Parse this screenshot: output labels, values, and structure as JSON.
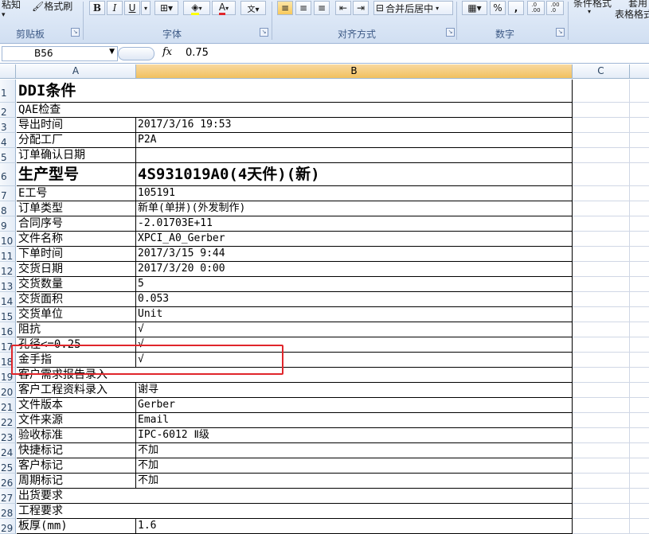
{
  "ribbon": {
    "clipboard": {
      "cut_partial": "粘知",
      "format_painter": "格式刷",
      "group_label": "剪贴板"
    },
    "font": {
      "bold": "B",
      "italic": "I",
      "underline": "U",
      "font_color": "A",
      "wen": "wén\n文",
      "group_label": "字体"
    },
    "alignment": {
      "merge_center": "合并后居中",
      "group_label": "对齐方式"
    },
    "number": {
      "percent": "%",
      "comma": ",",
      "inc_decimal": ".0\n.00",
      "dec_decimal": ".00\n.0",
      "group_label": "数字"
    },
    "styles": {
      "conditional_partial": "条件格式",
      "table_format_partial": "表格格式",
      "cell_styles_partial": "套用"
    }
  },
  "formula_bar": {
    "name_box": "B56",
    "fx": "fx",
    "value": "0.75"
  },
  "columns": [
    "A",
    "B",
    "C"
  ],
  "rows": [
    {
      "n": "1",
      "a": "DDI条件",
      "b": "",
      "style": "title"
    },
    {
      "n": "2",
      "a": "QAE检查",
      "b": "",
      "style": "span"
    },
    {
      "n": "3",
      "a": "导出时间",
      "b": "2017/3/16 19:53"
    },
    {
      "n": "4",
      "a": "分配工厂",
      "b": "P2A"
    },
    {
      "n": "5",
      "a": "订单确认日期",
      "b": ""
    },
    {
      "n": "6",
      "a": "生产型号",
      "b": "4S931019A0(4天件)(新)",
      "style": "big"
    },
    {
      "n": "7",
      "a": "E工号",
      "b": "105191"
    },
    {
      "n": "8",
      "a": "订单类型",
      "b": "新单(单拼)(外发制作)"
    },
    {
      "n": "9",
      "a": "合同序号",
      "b": "-2.01703E+11"
    },
    {
      "n": "10",
      "a": "文件名称",
      "b": "XPCI_A0_Gerber"
    },
    {
      "n": "11",
      "a": "下单时间",
      "b": "2017/3/15 9:44"
    },
    {
      "n": "12",
      "a": "交货日期",
      "b": "2017/3/20 0:00"
    },
    {
      "n": "13",
      "a": "交货数量",
      "b": "5"
    },
    {
      "n": "14",
      "a": "交货面积",
      "b": "0.053"
    },
    {
      "n": "15",
      "a": "交货单位",
      "b": "Unit"
    },
    {
      "n": "16",
      "a": "阻抗",
      "b": "√"
    },
    {
      "n": "17",
      "a": "孔径<=0.25",
      "b": "√"
    },
    {
      "n": "18",
      "a": "金手指",
      "b": "√"
    },
    {
      "n": "19",
      "a": "客户需求报告录入",
      "b": "",
      "style": "span"
    },
    {
      "n": "20",
      "a": "客户工程资料录入",
      "b": "谢寻"
    },
    {
      "n": "21",
      "a": "文件版本",
      "b": "Gerber"
    },
    {
      "n": "22",
      "a": "文件来源",
      "b": "Email"
    },
    {
      "n": "23",
      "a": "验收标准",
      "b": "IPC-6012 Ⅱ级"
    },
    {
      "n": "24",
      "a": "快捷标记",
      "b": "不加"
    },
    {
      "n": "25",
      "a": "客户标记",
      "b": "不加"
    },
    {
      "n": "26",
      "a": "周期标记",
      "b": "不加"
    },
    {
      "n": "27",
      "a": "出货要求",
      "b": "",
      "style": "span"
    },
    {
      "n": "28",
      "a": "工程要求",
      "b": "",
      "style": "span"
    },
    {
      "n": "29",
      "a": "板厚(mm)",
      "b": "1.6"
    }
  ],
  "colors": {
    "selected_col": "#f1c15f",
    "highlight_border": "#e0262b",
    "ribbon_label": "#3d5a86"
  }
}
